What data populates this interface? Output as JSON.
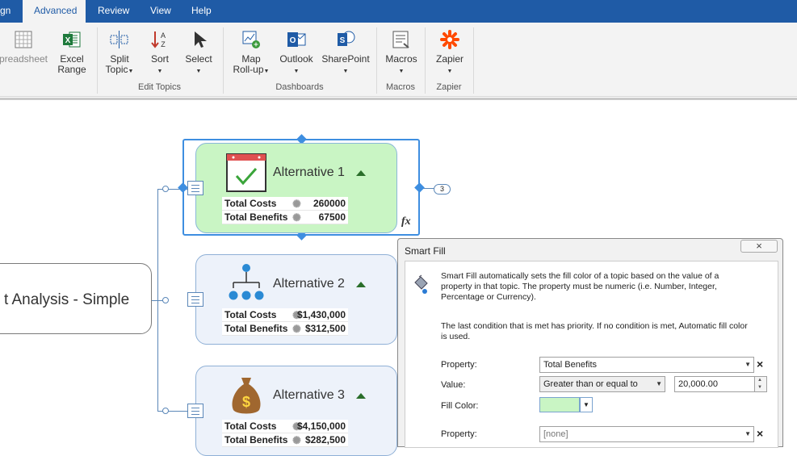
{
  "tabs": [
    {
      "label": "gn",
      "active": false
    },
    {
      "label": "Advanced",
      "active": true
    },
    {
      "label": "Review",
      "active": false
    },
    {
      "label": "View",
      "active": false
    },
    {
      "label": "Help",
      "active": false
    }
  ],
  "ribbon": {
    "buttons": {
      "spreadsheet": "preadsheet",
      "excel_range": [
        "Excel",
        "Range"
      ],
      "split_topic": [
        "Split",
        "Topic"
      ],
      "sort": "Sort",
      "select": "Select",
      "map_rollup": [
        "Map",
        "Roll-up"
      ],
      "outlook": "Outlook",
      "sharepoint": "SharePoint",
      "macros": "Macros",
      "zapier": "Zapier"
    },
    "groups": {
      "edit_topics": "Edit Topics",
      "dashboards": "Dashboards",
      "macros": "Macros",
      "zapier": "Zapier"
    },
    "icons": [
      "spreadsheet-icon",
      "excel-icon",
      "split-topic-icon",
      "sort-az-icon",
      "select-cursor-icon",
      "map-rollup-icon",
      "outlook-icon",
      "sharepoint-icon",
      "macros-icon",
      "zapier-icon"
    ]
  },
  "map": {
    "central_topic": "t Analysis - Simple",
    "topics": [
      {
        "title": "Alternative 1",
        "icon": "calendar-check-icon",
        "props": [
          {
            "label": "Total Costs",
            "value": "260000"
          },
          {
            "label": "Total Benefits",
            "value": "67500"
          }
        ],
        "fill": "#c9f5c4"
      },
      {
        "title": "Alternative 2",
        "icon": "org-chart-icon",
        "props": [
          {
            "label": "Total Costs",
            "value": "$1,430,000"
          },
          {
            "label": "Total Benefits",
            "value": "$312,500"
          }
        ],
        "fill": "#edf2fa"
      },
      {
        "title": "Alternative 3",
        "icon": "money-bag-icon",
        "props": [
          {
            "label": "Total Costs",
            "value": "$4,150,000"
          },
          {
            "label": "Total Benefits",
            "value": "$282,500"
          }
        ],
        "fill": "#edf2fa"
      }
    ],
    "collapsed_count": "3",
    "formula_mark": "fx"
  },
  "dialog": {
    "title": "Smart Fill",
    "close": "×",
    "description": [
      "Smart Fill automatically sets the fill color of a topic based on the value of a",
      "property in that topic. The property must be numeric (i.e. Number, Integer,",
      "Percentage or Currency)."
    ],
    "priority_note": [
      "The last condition that is met has priority. If no condition is met, Automatic fill color",
      "is used."
    ],
    "labels": {
      "property": "Property:",
      "value": "Value:",
      "fill_color": "Fill Color:"
    },
    "condition1": {
      "property": "Total Benefits",
      "operator": "Greater than or equal to",
      "value": "20,000.00",
      "fill_color": "#c9f5c4"
    },
    "condition2": {
      "property": "[none]"
    },
    "remove": "×"
  }
}
